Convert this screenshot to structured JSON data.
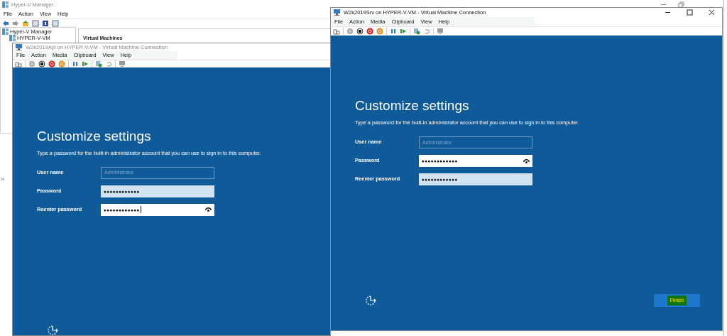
{
  "manager": {
    "title": "Hyper-V Manager",
    "menu": [
      "File",
      "Action",
      "View",
      "Help"
    ],
    "tree": [
      {
        "label": "Hyper-V Manager",
        "children": [
          {
            "label": "HYPER-V-VM"
          }
        ]
      }
    ],
    "panel_title": "Virtual Machines",
    "collapse_glyph": "»"
  },
  "vm_windows": [
    {
      "title": "W2k2019Apl on HYPER-V-VM - Virtual Machine Connection",
      "active": false,
      "menu": [
        "File",
        "Action",
        "Media",
        "Clipboard",
        "View",
        "Help"
      ],
      "heading": "Customize settings",
      "description": "Type a password for the built-in administrator account that you can use to sign in to this computer.",
      "fields": [
        {
          "label": "User name",
          "value": "Administrator",
          "disabled": true,
          "focused": false
        },
        {
          "label": "Password",
          "value": "●●●●●●●●●●●●",
          "disabled": false,
          "focused": false
        },
        {
          "label": "Reenter password",
          "value": "●●●●●●●●●●●●",
          "disabled": false,
          "focused": true
        }
      ]
    },
    {
      "title": "W2k2019Srv on HYPER-V-VM - Virtual Machine Connection",
      "active": true,
      "menu": [
        "File",
        "Action",
        "Media",
        "Clipboard",
        "View",
        "Help"
      ],
      "heading": "Customize settings",
      "description": "Type a password for the built-in administrator account that you can use to sign in to this computer.",
      "fields": [
        {
          "label": "User name",
          "value": "Administrator",
          "disabled": true,
          "focused": false
        },
        {
          "label": "Password",
          "value": "●●●●●●●●●●●●",
          "disabled": false,
          "focused": true
        },
        {
          "label": "Reenter password",
          "value": "●●●●●●●●●●●●",
          "disabled": false,
          "focused": false
        }
      ],
      "button": {
        "label": "Finish",
        "highlighted": true
      }
    }
  ]
}
